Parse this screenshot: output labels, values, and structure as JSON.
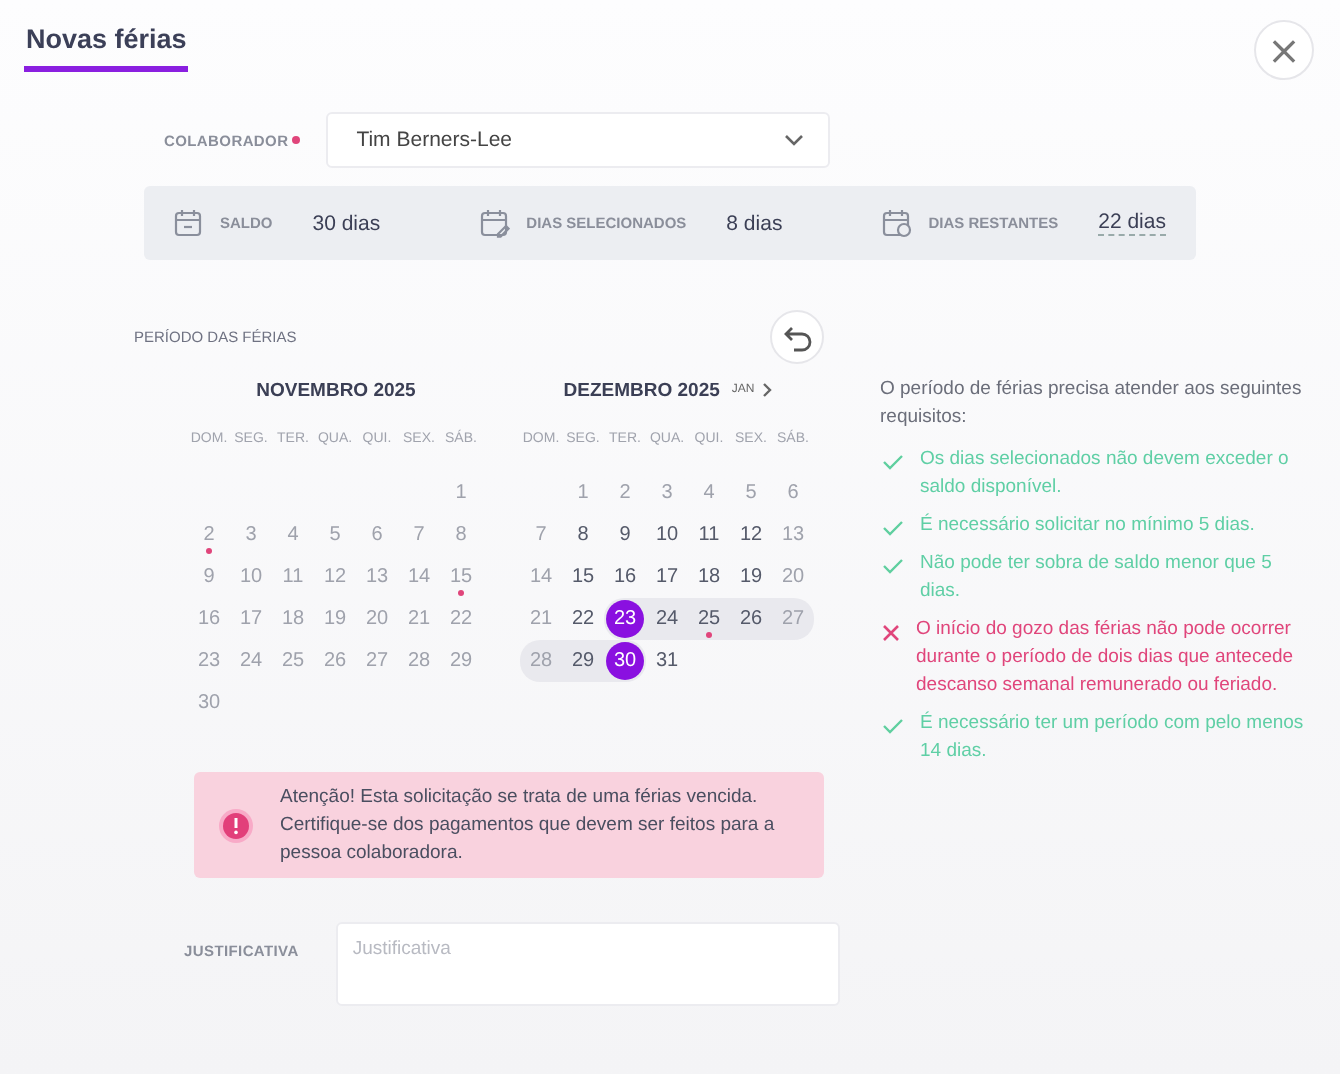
{
  "tab": {
    "label": "Novas férias",
    "selected": true
  },
  "close": {
    "label": "×"
  },
  "collaborator": {
    "label": "COLABORADOR",
    "required": true,
    "value": "Tim Berners-Lee"
  },
  "summary": [
    {
      "kind": "calendar",
      "label": "SALDO",
      "value": "30 dias",
      "underlined": false
    },
    {
      "kind": "calendar-edit",
      "label": "DIAS SELECIONADOS",
      "value": "8 dias",
      "underlined": false
    },
    {
      "kind": "calendar-clock",
      "label": "DIAS RESTANTES",
      "value": "22 dias",
      "underlined": true
    }
  ],
  "period": {
    "label": "PERÍODO DAS FÉRIAS"
  },
  "next_month": {
    "label": "JAN"
  },
  "months": [
    {
      "title": "NOVEMBRO 2025",
      "weekdays": [
        "DOM.",
        "SEG.",
        "TER.",
        "QUA.",
        "QUI.",
        "SEX.",
        "SÁB."
      ],
      "weeks": [
        {
          "kind": "leading",
          "days": [
            {
              "day": "1",
              "enabled": false,
              "selected": false,
              "in_range": false,
              "holiday": false
            }
          ]
        },
        {
          "kind": "full",
          "days": [
            {
              "day": "2",
              "enabled": false,
              "selected": false,
              "in_range": false,
              "holiday": true
            },
            {
              "day": "3",
              "enabled": false,
              "selected": false,
              "in_range": false,
              "holiday": false
            },
            {
              "day": "4",
              "enabled": false,
              "selected": false,
              "in_range": false,
              "holiday": false
            },
            {
              "day": "5",
              "enabled": false,
              "selected": false,
              "in_range": false,
              "holiday": false
            },
            {
              "day": "6",
              "enabled": false,
              "selected": false,
              "in_range": false,
              "holiday": false
            },
            {
              "day": "7",
              "enabled": false,
              "selected": false,
              "in_range": false,
              "holiday": false
            },
            {
              "day": "8",
              "enabled": false,
              "selected": false,
              "in_range": false,
              "holiday": false
            }
          ]
        },
        {
          "kind": "full",
          "days": [
            {
              "day": "9",
              "enabled": false,
              "selected": false,
              "in_range": false,
              "holiday": false
            },
            {
              "day": "10",
              "enabled": false,
              "selected": false,
              "in_range": false,
              "holiday": false
            },
            {
              "day": "11",
              "enabled": false,
              "selected": false,
              "in_range": false,
              "holiday": false
            },
            {
              "day": "12",
              "enabled": false,
              "selected": false,
              "in_range": false,
              "holiday": false
            },
            {
              "day": "13",
              "enabled": false,
              "selected": false,
              "in_range": false,
              "holiday": false
            },
            {
              "day": "14",
              "enabled": false,
              "selected": false,
              "in_range": false,
              "holiday": false
            },
            {
              "day": "15",
              "enabled": false,
              "selected": false,
              "in_range": false,
              "holiday": true
            }
          ]
        },
        {
          "kind": "full",
          "days": [
            {
              "day": "16",
              "enabled": false,
              "selected": false,
              "in_range": false,
              "holiday": false
            },
            {
              "day": "17",
              "enabled": false,
              "selected": false,
              "in_range": false,
              "holiday": false
            },
            {
              "day": "18",
              "enabled": false,
              "selected": false,
              "in_range": false,
              "holiday": false
            },
            {
              "day": "19",
              "enabled": false,
              "selected": false,
              "in_range": false,
              "holiday": false
            },
            {
              "day": "20",
              "enabled": false,
              "selected": false,
              "in_range": false,
              "holiday": false
            },
            {
              "day": "21",
              "enabled": false,
              "selected": false,
              "in_range": false,
              "holiday": false
            },
            {
              "day": "22",
              "enabled": false,
              "selected": false,
              "in_range": false,
              "holiday": false
            }
          ]
        },
        {
          "kind": "full",
          "days": [
            {
              "day": "23",
              "enabled": false,
              "selected": false,
              "in_range": false,
              "holiday": false
            },
            {
              "day": "24",
              "enabled": false,
              "selected": false,
              "in_range": false,
              "holiday": false
            },
            {
              "day": "25",
              "enabled": false,
              "selected": false,
              "in_range": false,
              "holiday": false
            },
            {
              "day": "26",
              "enabled": false,
              "selected": false,
              "in_range": false,
              "holiday": false
            },
            {
              "day": "27",
              "enabled": false,
              "selected": false,
              "in_range": false,
              "holiday": false
            },
            {
              "day": "28",
              "enabled": false,
              "selected": false,
              "in_range": false,
              "holiday": false
            },
            {
              "day": "29",
              "enabled": false,
              "selected": false,
              "in_range": false,
              "holiday": false
            }
          ]
        },
        {
          "kind": "trailing",
          "days": [
            {
              "day": "30",
              "enabled": false,
              "selected": false,
              "in_range": false,
              "holiday": false
            }
          ]
        }
      ]
    },
    {
      "title": "DEZEMBRO 2025",
      "weekdays": [
        "DOM.",
        "SEG.",
        "TER.",
        "QUA.",
        "QUI.",
        "SEX.",
        "SÁB."
      ],
      "weeks": [
        {
          "kind": "leading",
          "days": [
            {
              "day": "1",
              "enabled": false,
              "selected": false,
              "in_range": false,
              "holiday": false
            },
            {
              "day": "2",
              "enabled": false,
              "selected": false,
              "in_range": false,
              "holiday": false
            },
            {
              "day": "3",
              "enabled": false,
              "selected": false,
              "in_range": false,
              "holiday": false
            },
            {
              "day": "4",
              "enabled": false,
              "selected": false,
              "in_range": false,
              "holiday": false
            },
            {
              "day": "5",
              "enabled": false,
              "selected": false,
              "in_range": false,
              "holiday": false
            },
            {
              "day": "6",
              "enabled": false,
              "selected": false,
              "in_range": false,
              "holiday": false
            }
          ]
        },
        {
          "kind": "full",
          "days": [
            {
              "day": "7",
              "enabled": false,
              "selected": false,
              "in_range": false,
              "holiday": false
            },
            {
              "day": "8",
              "enabled": true,
              "selected": false,
              "in_range": false,
              "holiday": false
            },
            {
              "day": "9",
              "enabled": true,
              "selected": false,
              "in_range": false,
              "holiday": false
            },
            {
              "day": "10",
              "enabled": true,
              "selected": false,
              "in_range": false,
              "holiday": false
            },
            {
              "day": "11",
              "enabled": true,
              "selected": false,
              "in_range": false,
              "holiday": false
            },
            {
              "day": "12",
              "enabled": true,
              "selected": false,
              "in_range": false,
              "holiday": false
            },
            {
              "day": "13",
              "enabled": false,
              "selected": false,
              "in_range": false,
              "holiday": false
            }
          ]
        },
        {
          "kind": "full",
          "days": [
            {
              "day": "14",
              "enabled": false,
              "selected": false,
              "in_range": false,
              "holiday": false
            },
            {
              "day": "15",
              "enabled": true,
              "selected": false,
              "in_range": false,
              "holiday": false
            },
            {
              "day": "16",
              "enabled": true,
              "selected": false,
              "in_range": false,
              "holiday": false
            },
            {
              "day": "17",
              "enabled": true,
              "selected": false,
              "in_range": false,
              "holiday": false
            },
            {
              "day": "18",
              "enabled": true,
              "selected": false,
              "in_range": false,
              "holiday": false
            },
            {
              "day": "19",
              "enabled": true,
              "selected": false,
              "in_range": false,
              "holiday": false
            },
            {
              "day": "20",
              "enabled": false,
              "selected": false,
              "in_range": false,
              "holiday": false
            }
          ]
        },
        {
          "kind": "full",
          "days": [
            {
              "day": "21",
              "enabled": false,
              "selected": false,
              "in_range": false,
              "holiday": false
            },
            {
              "day": "22",
              "enabled": true,
              "selected": false,
              "in_range": false,
              "holiday": false
            },
            {
              "day": "23",
              "enabled": true,
              "selected": true,
              "in_range": true,
              "holiday": false
            },
            {
              "day": "24",
              "enabled": true,
              "selected": false,
              "in_range": true,
              "holiday": false
            },
            {
              "day": "25",
              "enabled": true,
              "selected": false,
              "in_range": true,
              "holiday": true
            },
            {
              "day": "26",
              "enabled": true,
              "selected": false,
              "in_range": true,
              "holiday": false
            },
            {
              "day": "27",
              "enabled": false,
              "selected": false,
              "in_range": true,
              "holiday": false
            }
          ]
        },
        {
          "kind": "trailing",
          "days": [
            {
              "day": "28",
              "enabled": false,
              "selected": false,
              "in_range": true,
              "holiday": false
            },
            {
              "day": "29",
              "enabled": true,
              "selected": false,
              "in_range": true,
              "holiday": false
            },
            {
              "day": "30",
              "enabled": true,
              "selected": true,
              "in_range": true,
              "holiday": false
            },
            {
              "day": "31",
              "enabled": true,
              "selected": false,
              "in_range": false,
              "holiday": false
            }
          ]
        }
      ]
    }
  ],
  "requirements": {
    "intro": "O período de férias precisa atender aos seguintes requisitos:",
    "items": [
      {
        "text": "Os dias selecionados não devem exceder o saldo disponível.",
        "ok": true
      },
      {
        "text": "É necessário solicitar no mínimo 5 dias.",
        "ok": true
      },
      {
        "text": "Não pode ter sobra de saldo menor que 5 dias.",
        "ok": true
      },
      {
        "text": "O início do gozo das férias não pode ocorrer durante o período de dois dias que antecede descanso semanal remunerado ou feriado.",
        "ok": false
      },
      {
        "text": "É necessário ter um período com pelo menos 14 dias.",
        "ok": true
      }
    ]
  },
  "alert": {
    "text": "Atenção! Esta solicitação se trata de uma férias vencida. Certifique-se dos pagamentos que devem ser feitos para a pessoa colaboradora."
  },
  "justification": {
    "label": "JUSTIFICATIVA",
    "placeholder": "Justificativa"
  }
}
